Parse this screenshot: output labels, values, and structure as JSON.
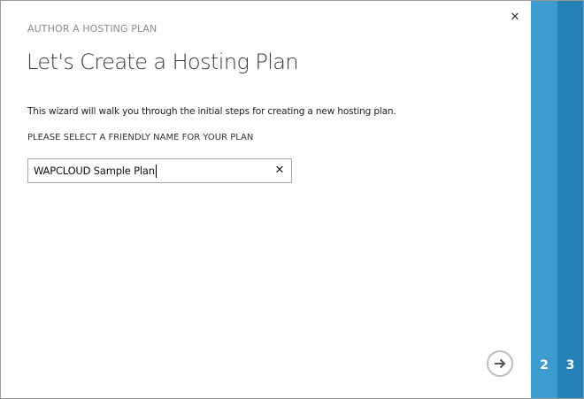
{
  "wizard": {
    "subtitle": "AUTHOR A HOSTING PLAN",
    "title": "Let's Create a Hosting Plan",
    "description": "This wizard will walk you through the initial steps for creating a new hosting plan.",
    "name_field": {
      "label": "PLEASE SELECT A FRIENDLY NAME FOR YOUR PLAN",
      "value": "WAPCLOUD Sample Plan",
      "clear_symbol": "✕"
    },
    "close_symbol": "✕",
    "next_icon": "arrow-right-circle-icon"
  },
  "steps": [
    {
      "label": "2",
      "color": "#3c9cd0"
    },
    {
      "label": "3",
      "color": "#2582b8"
    }
  ]
}
